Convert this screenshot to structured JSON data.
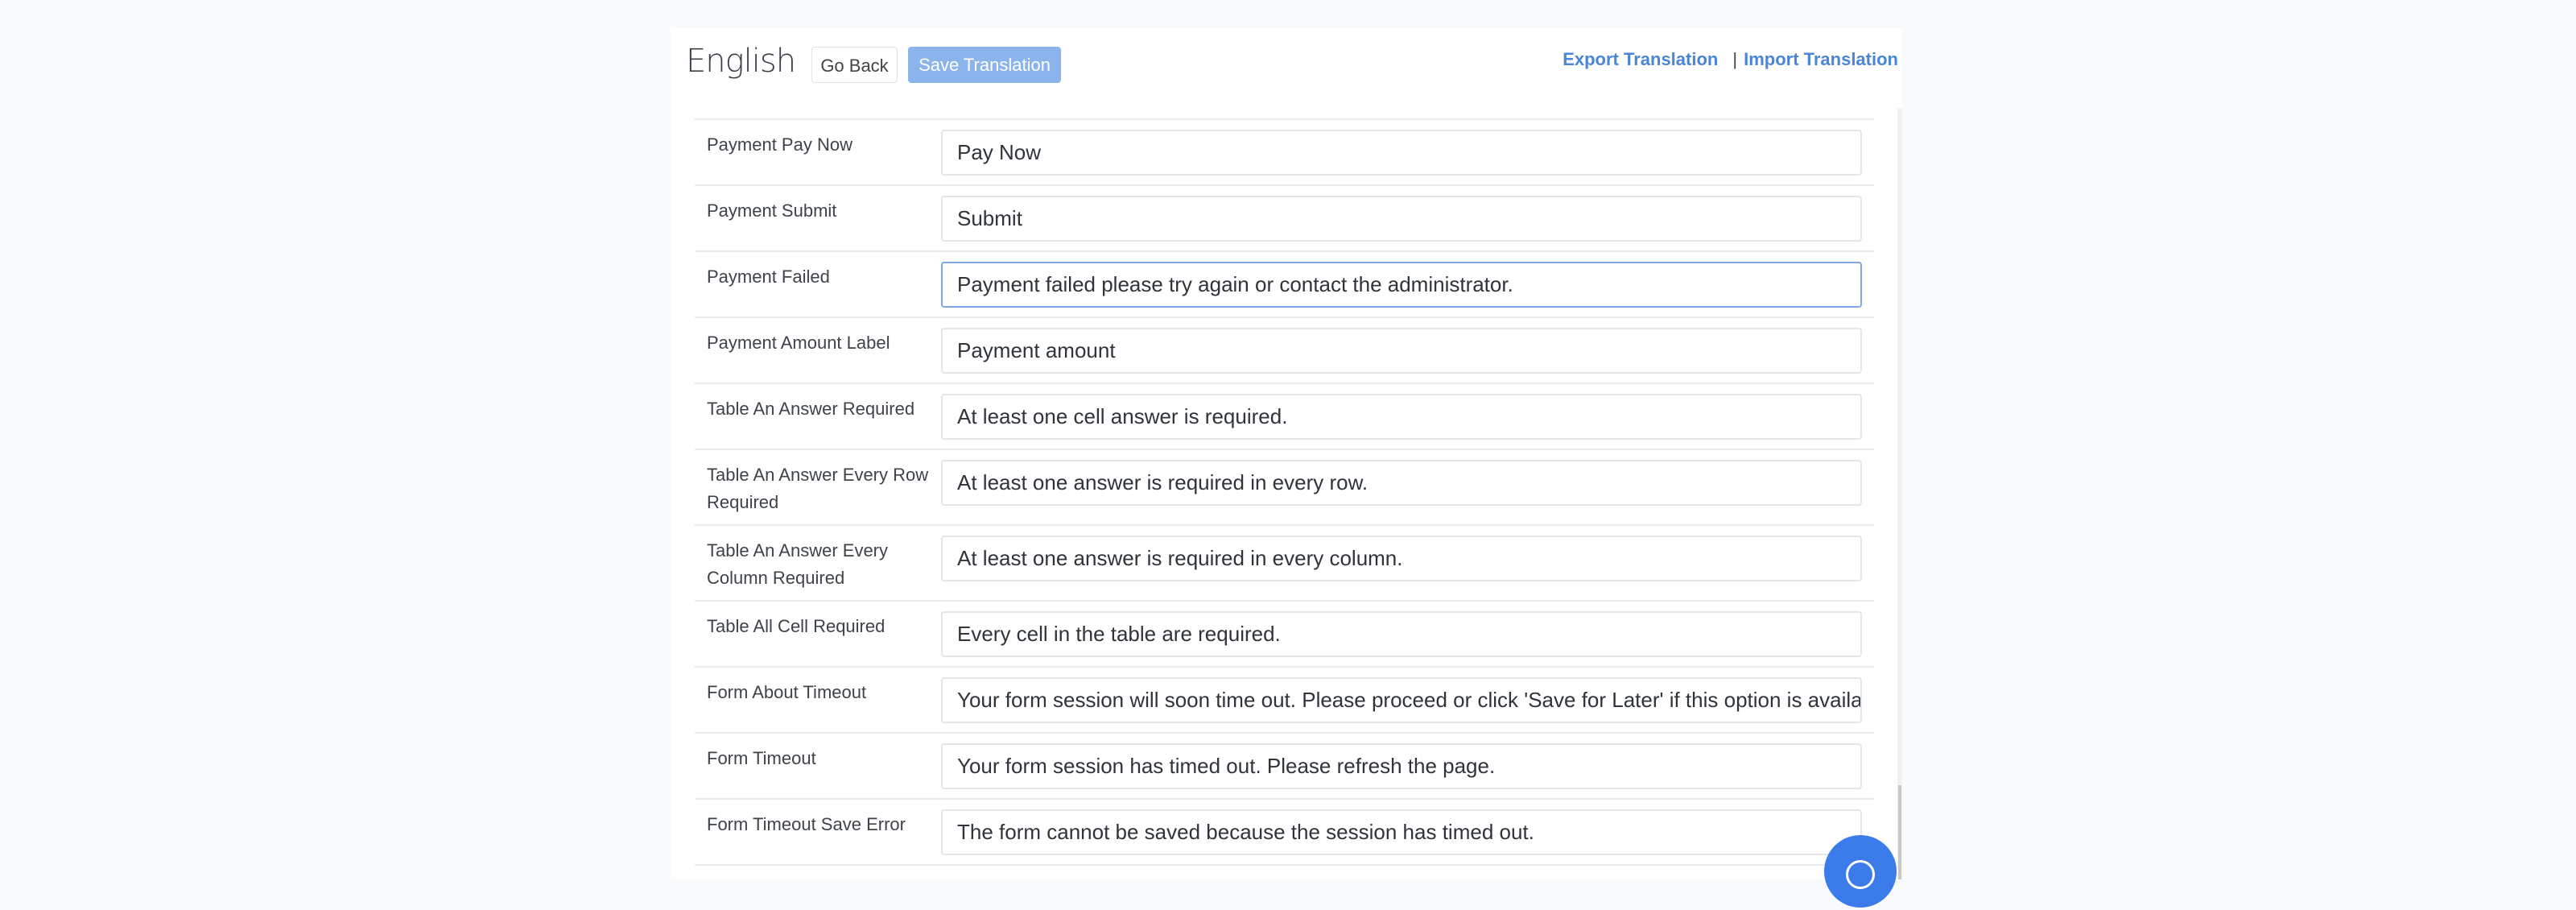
{
  "header": {
    "title": "English",
    "go_back": "Go Back",
    "save_translation": "Save Translation",
    "export_translation": "Export Translation",
    "separator": "|",
    "import_translation": "Import Translation"
  },
  "rows": [
    {
      "label": "Payment Pay Now",
      "value": "Pay Now"
    },
    {
      "label": "Payment Submit",
      "value": "Submit"
    },
    {
      "label": "Payment Failed",
      "value": "Payment failed please try again or contact the administrator."
    },
    {
      "label": "Payment Amount Label",
      "value": "Payment amount"
    },
    {
      "label": "Table An Answer Required",
      "value": "At least one cell answer is required."
    },
    {
      "label": "Table An Answer Every Row Required",
      "value": "At least one answer is required in every row."
    },
    {
      "label": "Table An Answer Every Column Required",
      "value": "At least one answer is required in every column."
    },
    {
      "label": "Table All Cell Required",
      "value": "Every cell in the table are required."
    },
    {
      "label": "Form About Timeout",
      "value": "Your form session will soon time out. Please proceed or click 'Save for Later' if this option is available."
    },
    {
      "label": "Form Timeout",
      "value": "Your form session has timed out. Please refresh the page."
    },
    {
      "label": "Form Timeout Save Error",
      "value": "The form cannot be saved because the session has timed out."
    }
  ],
  "colors": {
    "accent": "#4a86d8",
    "save_button": "#8cb4ec",
    "chat": "#3b7bea"
  }
}
